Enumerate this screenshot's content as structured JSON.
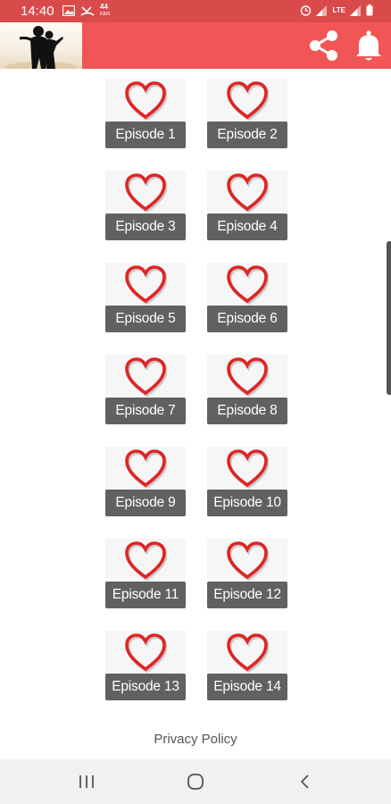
{
  "status_bar": {
    "time": "14:40",
    "speed_value": "44",
    "speed_unit": "KB/S",
    "network_label": "LTE"
  },
  "app_bar": {
    "logo_icon": "couple-silhouette-logo",
    "share_icon": "share-icon",
    "notification_icon": "bell-icon"
  },
  "episodes": [
    {
      "label": "Episode 1"
    },
    {
      "label": "Episode 2"
    },
    {
      "label": "Episode 3"
    },
    {
      "label": "Episode 4"
    },
    {
      "label": "Episode 5"
    },
    {
      "label": "Episode 6"
    },
    {
      "label": "Episode 7"
    },
    {
      "label": "Episode 8"
    },
    {
      "label": "Episode 9"
    },
    {
      "label": "Episode 10"
    },
    {
      "label": "Episode 11"
    },
    {
      "label": "Episode 12"
    },
    {
      "label": "Episode 13"
    },
    {
      "label": "Episode 14"
    }
  ],
  "footer": {
    "privacy_label": "Privacy Policy"
  },
  "colors": {
    "app_bar": "#f05656",
    "status_bar": "#d94a4a",
    "heart": "#e02424",
    "label_bg": "#616161"
  }
}
